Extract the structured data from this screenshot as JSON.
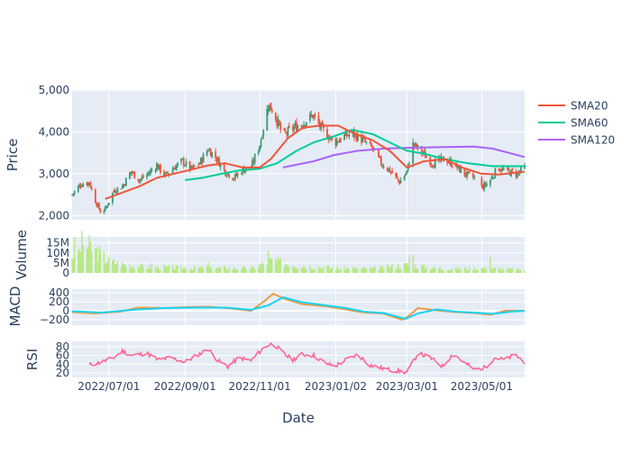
{
  "chart_data": {
    "type": "candlestick",
    "title": "",
    "xlabel": "Date",
    "x_tick_labels": [
      "2022/07/01",
      "2022/09/01",
      "2022/11/01",
      "2023/01/02",
      "2023/03/01",
      "2023/05/01"
    ],
    "x_tick_dates": [
      "2022-07-01",
      "2022-09-01",
      "2022-11-01",
      "2023-01-02",
      "2023-03-01",
      "2023-05-01"
    ],
    "x_range": [
      "2022-06-01",
      "2023-06-05"
    ],
    "colors": {
      "up": "#3D9970",
      "down": "#EF553B",
      "sma20": "#EF553B",
      "sma60": "#00CC96",
      "sma120": "#AB63FA",
      "volume": "#B6E880",
      "macd": "#EF9A44",
      "signal": "#19D3F3",
      "rsi": "#FF6692",
      "plot_bg": "#E5ECF6",
      "grid": "#ffffff",
      "text": "#2a3f5f"
    },
    "legend_position": "top-right",
    "panels": [
      {
        "id": "price",
        "ylabel": "Price",
        "ylim": [
          1900,
          5000
        ],
        "ticks": [
          2000,
          3000,
          4000,
          5000
        ],
        "tick_labels": [
          "2,000",
          "3,000",
          "4,000",
          "5,000"
        ]
      },
      {
        "id": "volume",
        "ylabel": "Volume",
        "ylim": [
          0,
          18000000
        ],
        "ticks": [
          0,
          5000000,
          10000000,
          15000000
        ],
        "tick_labels": [
          "0",
          "5M",
          "10M",
          "15M"
        ]
      },
      {
        "id": "macd",
        "ylabel": "MACD",
        "ylim": [
          -320,
          480
        ],
        "ticks": [
          -200,
          0,
          200,
          400
        ],
        "tick_labels": [
          "−200",
          "0",
          "200",
          "400"
        ]
      },
      {
        "id": "rsi",
        "ylabel": "RSI",
        "ylim": [
          10,
          92
        ],
        "ticks": [
          20,
          40,
          60,
          80
        ],
        "tick_labels": [
          "20",
          "40",
          "60",
          "80"
        ]
      }
    ],
    "price_path": [
      [
        "2022-06-01",
        2500
      ],
      [
        "2022-06-08",
        2750
      ],
      [
        "2022-06-15",
        2800
      ],
      [
        "2022-06-20",
        2350
      ],
      [
        "2022-06-24",
        2100
      ],
      [
        "2022-06-28",
        2150
      ],
      [
        "2022-07-05",
        2600
      ],
      [
        "2022-07-12",
        2700
      ],
      [
        "2022-07-19",
        3050
      ],
      [
        "2022-07-26",
        2850
      ],
      [
        "2022-08-02",
        3000
      ],
      [
        "2022-08-09",
        3200
      ],
      [
        "2022-08-16",
        2950
      ],
      [
        "2022-08-23",
        3150
      ],
      [
        "2022-08-30",
        3300
      ],
      [
        "2022-09-06",
        3100
      ],
      [
        "2022-09-13",
        3250
      ],
      [
        "2022-09-20",
        3600
      ],
      [
        "2022-09-27",
        3350
      ],
      [
        "2022-10-04",
        3050
      ],
      [
        "2022-10-11",
        2900
      ],
      [
        "2022-10-18",
        3100
      ],
      [
        "2022-10-25",
        3150
      ],
      [
        "2022-11-01",
        3700
      ],
      [
        "2022-11-08",
        4650
      ],
      [
        "2022-11-12",
        4500
      ],
      [
        "2022-11-20",
        3900
      ],
      [
        "2022-11-28",
        4100
      ],
      [
        "2022-12-06",
        4200
      ],
      [
        "2022-12-14",
        4400
      ],
      [
        "2022-12-22",
        4050
      ],
      [
        "2023-01-01",
        3750
      ],
      [
        "2023-01-09",
        3900
      ],
      [
        "2023-01-16",
        3950
      ],
      [
        "2023-01-24",
        3800
      ],
      [
        "2023-02-01",
        3600
      ],
      [
        "2023-02-08",
        3250
      ],
      [
        "2023-02-16",
        3050
      ],
      [
        "2023-02-23",
        2800
      ],
      [
        "2023-03-01",
        3050
      ],
      [
        "2023-03-06",
        3700
      ],
      [
        "2023-03-12",
        3550
      ],
      [
        "2023-03-22",
        3250
      ],
      [
        "2023-04-01",
        3350
      ],
      [
        "2023-04-09",
        3200
      ],
      [
        "2023-04-17",
        3000
      ],
      [
        "2023-04-25",
        2900
      ],
      [
        "2023-04-30",
        2650
      ],
      [
        "2023-05-07",
        2800
      ],
      [
        "2023-05-14",
        3150
      ],
      [
        "2023-05-22",
        3050
      ],
      [
        "2023-05-30",
        3000
      ],
      [
        "2023-06-05",
        3150
      ]
    ],
    "price_gaps": [
      [
        "2023-04-26",
        "2023-04-30"
      ]
    ],
    "sma20": [
      [
        "2022-06-28",
        2400
      ],
      [
        "2022-07-12",
        2550
      ],
      [
        "2022-07-26",
        2700
      ],
      [
        "2022-08-09",
        2900
      ],
      [
        "2022-08-23",
        3000
      ],
      [
        "2022-09-06",
        3100
      ],
      [
        "2022-09-20",
        3200
      ],
      [
        "2022-10-04",
        3250
      ],
      [
        "2022-10-18",
        3150
      ],
      [
        "2022-11-01",
        3150
      ],
      [
        "2022-11-10",
        3350
      ],
      [
        "2022-11-24",
        3850
      ],
      [
        "2022-12-06",
        4100
      ],
      [
        "2022-12-20",
        4150
      ],
      [
        "2023-01-04",
        4150
      ],
      [
        "2023-01-18",
        3950
      ],
      [
        "2023-02-01",
        3800
      ],
      [
        "2023-02-15",
        3550
      ],
      [
        "2023-03-01",
        3150
      ],
      [
        "2023-03-15",
        3300
      ],
      [
        "2023-04-01",
        3350
      ],
      [
        "2023-04-15",
        3150
      ],
      [
        "2023-05-01",
        3000
      ],
      [
        "2023-05-15",
        2980
      ],
      [
        "2023-06-05",
        3050
      ]
    ],
    "sma60": [
      [
        "2022-09-01",
        2850
      ],
      [
        "2022-09-15",
        2900
      ],
      [
        "2022-10-01",
        3000
      ],
      [
        "2022-10-15",
        3080
      ],
      [
        "2022-11-01",
        3120
      ],
      [
        "2022-11-15",
        3250
      ],
      [
        "2022-12-01",
        3550
      ],
      [
        "2022-12-15",
        3750
      ],
      [
        "2023-01-01",
        3900
      ],
      [
        "2023-01-15",
        4050
      ],
      [
        "2023-02-01",
        3950
      ],
      [
        "2023-02-15",
        3750
      ],
      [
        "2023-03-01",
        3550
      ],
      [
        "2023-03-15",
        3480
      ],
      [
        "2023-04-01",
        3350
      ],
      [
        "2023-04-20",
        3250
      ],
      [
        "2023-05-10",
        3180
      ],
      [
        "2023-06-05",
        3180
      ]
    ],
    "sma120": [
      [
        "2022-11-20",
        3150
      ],
      [
        "2022-12-15",
        3300
      ],
      [
        "2023-01-01",
        3450
      ],
      [
        "2023-01-20",
        3550
      ],
      [
        "2023-02-10",
        3600
      ],
      [
        "2023-03-01",
        3620
      ],
      [
        "2023-04-01",
        3640
      ],
      [
        "2023-04-25",
        3650
      ],
      [
        "2023-05-10",
        3600
      ],
      [
        "2023-06-05",
        3400
      ]
    ],
    "volume_path": [
      [
        "2022-06-01",
        9000000
      ],
      [
        "2022-06-10",
        15000000
      ],
      [
        "2022-06-20",
        11000000
      ],
      [
        "2022-07-01",
        6000000
      ],
      [
        "2022-07-15",
        4000000
      ],
      [
        "2022-08-01",
        3000000
      ],
      [
        "2022-09-01",
        2500000
      ],
      [
        "2022-10-01",
        2500000
      ],
      [
        "2022-10-25",
        2200000
      ],
      [
        "2022-11-10",
        6000000
      ],
      [
        "2022-12-01",
        4000000
      ],
      [
        "2023-01-01",
        2500000
      ],
      [
        "2023-02-01",
        2000000
      ],
      [
        "2023-03-01",
        4000000
      ],
      [
        "2023-04-01",
        2000000
      ],
      [
        "2023-05-01",
        2500000
      ],
      [
        "2023-06-05",
        1500000
      ]
    ],
    "volume_peaks": [
      [
        "2022-06-03",
        17500000
      ],
      [
        "2022-06-07",
        12000000
      ],
      [
        "2022-06-12",
        10000000
      ],
      [
        "2022-11-08",
        11000000
      ],
      [
        "2022-11-14",
        7000000
      ],
      [
        "2023-03-03",
        8000000
      ],
      [
        "2023-03-06",
        9000000
      ],
      [
        "2023-05-08",
        8000000
      ],
      [
        "2022-09-20",
        5500000
      ],
      [
        "2022-08-05",
        5000000
      ]
    ],
    "macd": [
      [
        "2022-06-01",
        -30
      ],
      [
        "2022-06-20",
        -60
      ],
      [
        "2022-07-10",
        -20
      ],
      [
        "2022-07-25",
        70
      ],
      [
        "2022-08-15",
        60
      ],
      [
        "2022-09-01",
        80
      ],
      [
        "2022-09-20",
        90
      ],
      [
        "2022-10-05",
        60
      ],
      [
        "2022-10-25",
        0
      ],
      [
        "2022-11-05",
        220
      ],
      [
        "2022-11-12",
        380
      ],
      [
        "2022-11-20",
        280
      ],
      [
        "2022-12-05",
        150
      ],
      [
        "2022-12-25",
        100
      ],
      [
        "2023-01-10",
        30
      ],
      [
        "2023-01-25",
        -40
      ],
      [
        "2023-02-10",
        -60
      ],
      [
        "2023-02-25",
        -200
      ],
      [
        "2023-03-01",
        -150
      ],
      [
        "2023-03-10",
        60
      ],
      [
        "2023-03-25",
        10
      ],
      [
        "2023-04-10",
        -30
      ],
      [
        "2023-04-25",
        -50
      ],
      [
        "2023-05-08",
        -90
      ],
      [
        "2023-05-20",
        0
      ],
      [
        "2023-06-05",
        0
      ]
    ],
    "signal": [
      [
        "2022-06-01",
        -10
      ],
      [
        "2022-06-25",
        -40
      ],
      [
        "2022-07-20",
        20
      ],
      [
        "2022-08-15",
        60
      ],
      [
        "2022-09-10",
        70
      ],
      [
        "2022-10-05",
        70
      ],
      [
        "2022-10-25",
        20
      ],
      [
        "2022-11-08",
        120
      ],
      [
        "2022-11-20",
        300
      ],
      [
        "2022-12-05",
        190
      ],
      [
        "2022-12-25",
        120
      ],
      [
        "2023-01-10",
        60
      ],
      [
        "2023-01-25",
        -20
      ],
      [
        "2023-02-10",
        -50
      ],
      [
        "2023-02-28",
        -180
      ],
      [
        "2023-03-10",
        -60
      ],
      [
        "2023-03-25",
        30
      ],
      [
        "2023-04-10",
        -20
      ],
      [
        "2023-04-25",
        -40
      ],
      [
        "2023-05-10",
        -70
      ],
      [
        "2023-05-25",
        -20
      ],
      [
        "2023-06-05",
        0
      ]
    ],
    "rsi": [
      [
        "2022-06-15",
        38
      ],
      [
        "2022-06-25",
        45
      ],
      [
        "2022-07-05",
        55
      ],
      [
        "2022-07-12",
        70
      ],
      [
        "2022-07-20",
        60
      ],
      [
        "2022-08-01",
        65
      ],
      [
        "2022-08-10",
        50
      ],
      [
        "2022-08-20",
        55
      ],
      [
        "2022-09-01",
        45
      ],
      [
        "2022-09-12",
        62
      ],
      [
        "2022-09-20",
        75
      ],
      [
        "2022-09-28",
        48
      ],
      [
        "2022-10-06",
        35
      ],
      [
        "2022-10-15",
        55
      ],
      [
        "2022-10-25",
        48
      ],
      [
        "2022-11-05",
        80
      ],
      [
        "2022-11-12",
        88
      ],
      [
        "2022-11-20",
        65
      ],
      [
        "2022-11-28",
        50
      ],
      [
        "2022-12-05",
        62
      ],
      [
        "2022-12-15",
        60
      ],
      [
        "2022-12-25",
        42
      ],
      [
        "2023-01-01",
        35
      ],
      [
        "2023-01-10",
        50
      ],
      [
        "2023-01-20",
        62
      ],
      [
        "2023-01-30",
        38
      ],
      [
        "2023-02-10",
        30
      ],
      [
        "2023-02-20",
        25
      ],
      [
        "2023-03-01",
        22
      ],
      [
        "2023-03-05",
        40
      ],
      [
        "2023-03-10",
        65
      ],
      [
        "2023-03-20",
        55
      ],
      [
        "2023-03-30",
        35
      ],
      [
        "2023-04-08",
        65
      ],
      [
        "2023-04-16",
        45
      ],
      [
        "2023-04-25",
        28
      ],
      [
        "2023-05-03",
        32
      ],
      [
        "2023-05-12",
        55
      ],
      [
        "2023-05-20",
        50
      ],
      [
        "2023-05-28",
        62
      ],
      [
        "2023-06-05",
        45
      ]
    ],
    "series": [
      {
        "name": "SMA20"
      },
      {
        "name": "SMA60"
      },
      {
        "name": "SMA120"
      }
    ]
  }
}
